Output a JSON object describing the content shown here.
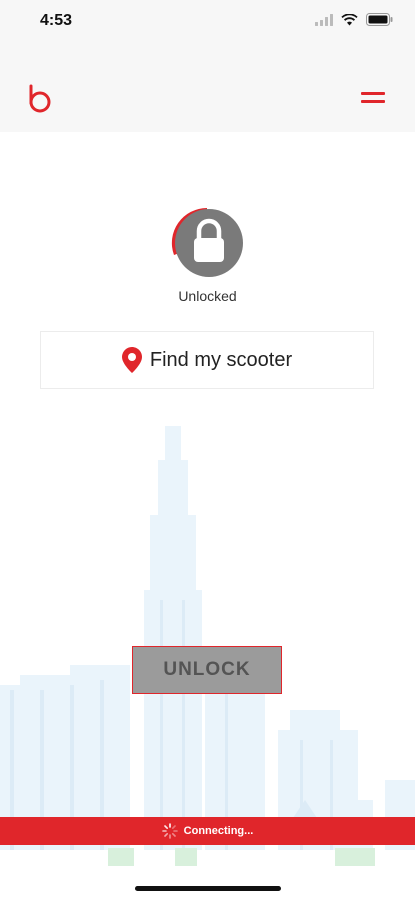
{
  "status_bar": {
    "time": "4:53"
  },
  "lock": {
    "state_label": "Unlocked"
  },
  "find_scooter": {
    "label": "Find my scooter"
  },
  "unlock_button": {
    "label": "UNLOCK"
  },
  "connection": {
    "text": "Connecting..."
  },
  "colors": {
    "accent": "#e0262b",
    "button_gray": "#9b9b9b",
    "lock_gray": "#7a7a7a",
    "header_bg": "#f7f7f7"
  },
  "icons": [
    "signal-icon",
    "wifi-icon",
    "battery-icon",
    "brand-logo",
    "menu-icon",
    "padlock-icon",
    "location-pin-icon",
    "spinner-icon"
  ]
}
